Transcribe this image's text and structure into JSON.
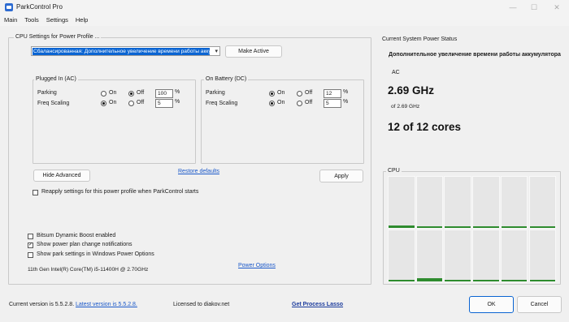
{
  "window": {
    "title": "ParkControl Pro",
    "controls": {
      "minimize": "—",
      "maximize": "☐",
      "close": "✕"
    }
  },
  "menu": [
    "Main",
    "Tools",
    "Settings",
    "Help"
  ],
  "cpu_settings": {
    "group_title": "CPU Settings for Power Profile ...",
    "profile_value": "Сбалансированная: Дополнительное увеличение времени работы аккумулятора",
    "make_active_label": "Make Active",
    "plugged_in": {
      "title": "Plugged In (AC)",
      "parking_label": "Parking",
      "freq_label": "Freq Scaling",
      "on_label": "On",
      "off_label": "Off",
      "parking_selected": "Off",
      "parking_value": "100",
      "freq_selected": "On",
      "freq_value": "5",
      "unit": "%"
    },
    "on_battery": {
      "title": "On Battery (DC)",
      "parking_label": "Parking",
      "freq_label": "Freq Scaling",
      "on_label": "On",
      "off_label": "Off",
      "parking_selected": "On",
      "parking_value": "12",
      "freq_selected": "On",
      "freq_value": "5",
      "unit": "%"
    },
    "hide_advanced_label": "Hide Advanced",
    "restore_defaults_label": "Restore defaults",
    "apply_label": "Apply",
    "reapply_label": "Reapply settings for this power profile when ParkControl starts",
    "reapply_checked": false
  },
  "options": [
    {
      "label": "Bitsum Dynamic Boost enabled",
      "checked": false
    },
    {
      "label": "Show power plan change notifications",
      "checked": true
    },
    {
      "label": "Show park settings in Windows Power Options",
      "checked": false
    }
  ],
  "cpu_name": "11th Gen Intel(R) Core(TM) i5-11400H @ 2.70GHz",
  "power_options_label": "Power Options",
  "status": {
    "title": "Current System Power Status",
    "profile": "Дополнительное увеличение времени работы аккумулятора",
    "source": "AC",
    "freq": "2.69 GHz",
    "freq_of": "of 2.69 GHz",
    "cores": "12 of 12 cores"
  },
  "cpu_graph": {
    "title": "CPU",
    "bar_color": "#2e8b2e",
    "core_loads": [
      0.05,
      0.03,
      0.02,
      0.02,
      0.02,
      0.02,
      0.02,
      0.06,
      0.02,
      0.02,
      0.02,
      0.02
    ]
  },
  "footer": {
    "current_version": "Current version is 5.5.2.8.",
    "latest_version": "Latest version is 5.5.2.8.",
    "licensed": "Licensed to diakov.net",
    "get_lasso": "Get Process Lasso",
    "ok_label": "OK",
    "cancel_label": "Cancel"
  }
}
